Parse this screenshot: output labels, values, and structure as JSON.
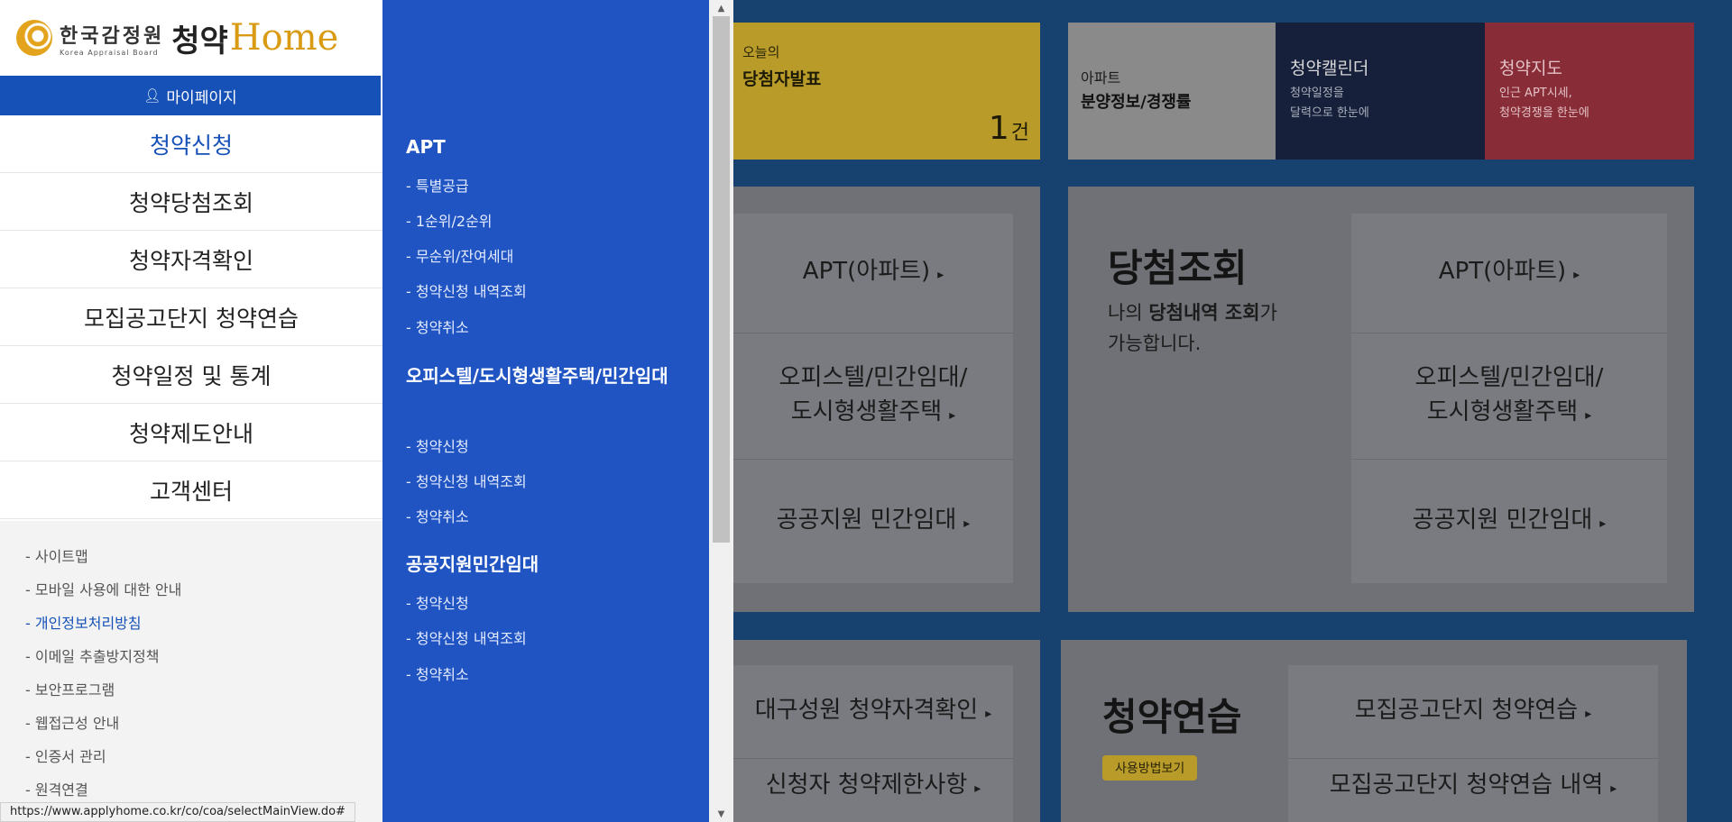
{
  "logo": {
    "korean": "한국감정원",
    "english": "Korea Appraisal Board",
    "chungyak": "청약",
    "home": "Home"
  },
  "mypage": {
    "label": "마이페이지"
  },
  "main_nav": [
    "청약신청",
    "청약당첨조회",
    "청약자격확인",
    "모집공고단지 청약연습",
    "청약일정 및 통계",
    "청약제도안내",
    "고객센터"
  ],
  "footer_links": [
    "- 사이트맵",
    "- 모바일 사용에 대한 안내",
    "- 개인정보처리방침",
    "- 이메일 추출방지정책",
    "- 보안프로그램",
    "- 웹접근성 안내",
    "- 인증서 관리",
    "- 원격연결"
  ],
  "submenu": {
    "sections": [
      {
        "title": "APT",
        "items": [
          "- 특별공급",
          "- 1순위/2순위",
          "- 무순위/잔여세대",
          "- 청약신청 내역조회",
          "- 청약취소"
        ]
      },
      {
        "title": "오피스텔/도시형생활주택/민간임대",
        "items": [
          "- 청약신청",
          "- 청약신청 내역조회",
          "- 청약취소"
        ]
      },
      {
        "title": "공공지원민간임대",
        "items": [
          "- 청약신청",
          "- 청약신청 내역조회",
          "- 청약취소"
        ]
      }
    ]
  },
  "tiles": {
    "today": {
      "small": "오늘의",
      "big": "당첨자발표",
      "count": "1",
      "unit": "건"
    },
    "apt": {
      "small": "아파트",
      "big": "분양정보/경쟁률"
    },
    "calendar": {
      "big": "청약캘린더",
      "small1": "청약일정을",
      "small2": "달력으로 한눈에"
    },
    "map": {
      "big": "청약지도",
      "small1": "인근 APT시세,",
      "small2": "청약경쟁을 한눈에"
    }
  },
  "panel_left_menu": [
    "APT(아파트)",
    "오피스텔/민간임대/",
    "도시형생활주택",
    "공공지원 민간임대"
  ],
  "win": {
    "title": "당첨조회",
    "desc1": "나의",
    "desc_bold": "당첨내역 조회",
    "desc2": "가",
    "desc3": "가능합니다.",
    "menu": [
      "APT(아파트)",
      "오피스텔/민간임대/",
      "도시형생활주택",
      "공공지원 민간임대"
    ]
  },
  "bottom_left_menu": [
    "대구성원 청약자격확인",
    "신청자 청약제한사항"
  ],
  "practice": {
    "title": "청약연습",
    "badge": "사용방법보기",
    "menu": [
      "모집공고단지 청약연습",
      "모집공고단지 청약연습 내역"
    ]
  },
  "status_url": "https://www.applyhome.co.kr/co/coa/selectMainView.do#",
  "colors": {
    "blue": "#1651b8",
    "submenu_blue": "#1f54c2",
    "gold": "#d99a14"
  }
}
